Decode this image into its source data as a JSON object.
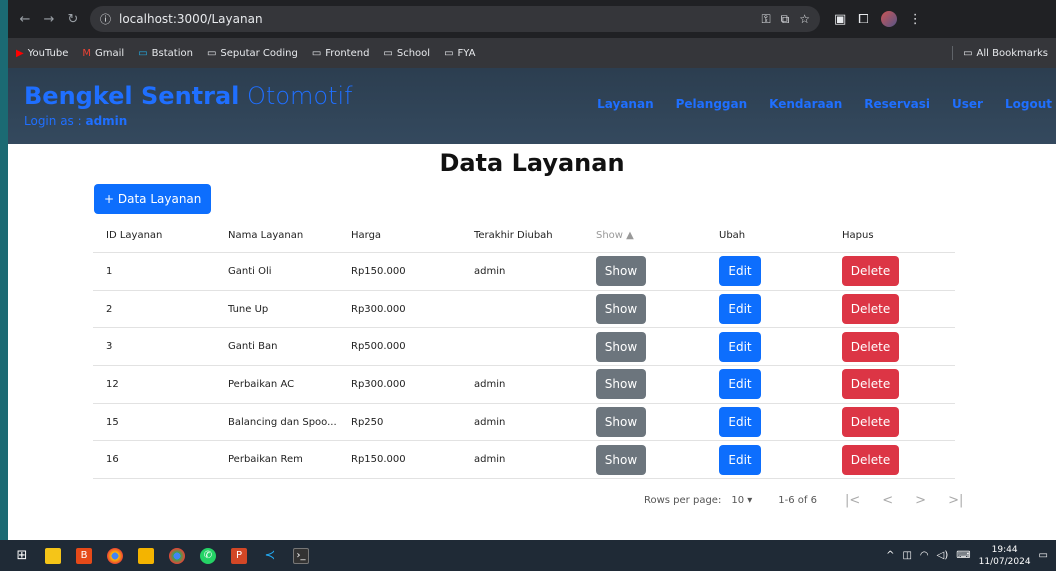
{
  "browser": {
    "url": "localhost:3000/Layanan",
    "bookmarks": [
      "YouTube",
      "Gmail",
      "Bstation",
      "Seputar Coding",
      "Frontend",
      "School",
      "FYA"
    ],
    "all_bookmarks": "All Bookmarks"
  },
  "app": {
    "brand_bold": "Bengkel Sentral",
    "brand_thin": "Otomotif",
    "login_prefix": "Login as : ",
    "login_user": "admin",
    "menu": [
      "Layanan",
      "Pelanggan",
      "Kendaraan",
      "Reservasi",
      "User",
      "Logout"
    ]
  },
  "page": {
    "title": "Data Layanan",
    "add_button": "+ Data Layanan"
  },
  "table": {
    "headers": [
      "ID Layanan",
      "Nama Layanan",
      "Harga",
      "Terakhir Diubah",
      "Show ▲",
      "Ubah",
      "Hapus"
    ],
    "rows": [
      {
        "id": "1",
        "nama": "Ganti Oli",
        "harga": "Rp150.000",
        "diubah": "admin"
      },
      {
        "id": "2",
        "nama": "Tune Up",
        "harga": "Rp300.000",
        "diubah": ""
      },
      {
        "id": "3",
        "nama": "Ganti Ban",
        "harga": "Rp500.000",
        "diubah": ""
      },
      {
        "id": "12",
        "nama": "Perbaikan AC",
        "harga": "Rp300.000",
        "diubah": "admin"
      },
      {
        "id": "15",
        "nama": "Balancing dan Spoo...",
        "harga": "Rp250",
        "diubah": "admin"
      },
      {
        "id": "16",
        "nama": "Perbaikan Rem",
        "harga": "Rp150.000",
        "diubah": "admin"
      }
    ],
    "show_label": "Show",
    "edit_label": "Edit",
    "delete_label": "Delete"
  },
  "pagination": {
    "rows_per_page_label": "Rows per page:",
    "rows_per_page": "10",
    "range": "1-6 of 6"
  },
  "taskbar": {
    "time": "19:44",
    "date": "11/07/2024"
  },
  "colors": {
    "primary": "#0d6efd",
    "secondary": "#6c757d",
    "danger": "#dc3545",
    "header": "#2c3e50"
  }
}
